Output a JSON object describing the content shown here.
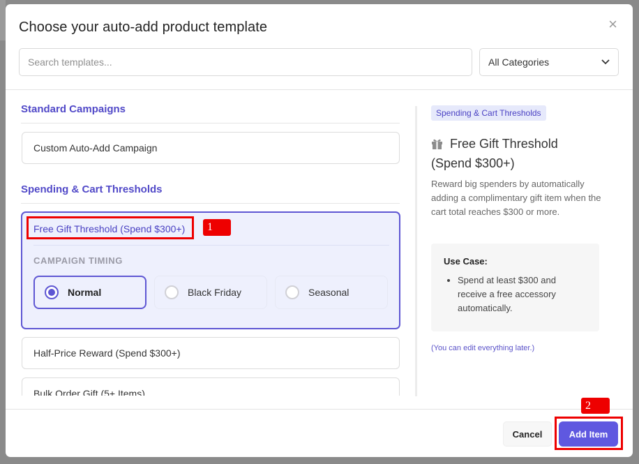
{
  "modal": {
    "title": "Choose your auto-add product template",
    "close_glyph": "×"
  },
  "search": {
    "placeholder": "Search templates..."
  },
  "category_select": {
    "value": "All Categories"
  },
  "sections": [
    {
      "title": "Standard Campaigns",
      "items": [
        "Custom Auto-Add Campaign"
      ]
    },
    {
      "title": "Spending & Cart Thresholds",
      "selected_item": {
        "label": "Free Gift Threshold (Spend $300+)",
        "timing_label": "CAMPAIGN TIMING",
        "options": [
          "Normal",
          "Black Friday",
          "Seasonal"
        ],
        "selected_option": "Normal"
      },
      "items": [
        "Half-Price Reward (Spend $300+)",
        "Bulk Order Gift (5+ Items)"
      ]
    }
  ],
  "details": {
    "tag": "Spending & Cart Thresholds",
    "icon": "gift-icon",
    "title": "Free Gift Threshold (Spend $300+)",
    "description": "Reward big spenders by automatically adding a complimentary gift item when the cart total reaches $300 or more.",
    "use_case_title": "Use Case:",
    "use_case_items": [
      "Spend at least $300 and receive a free accessory automatically."
    ],
    "note": "(You can edit everything later.)"
  },
  "footer": {
    "cancel_label": "Cancel",
    "add_label": "Add Item"
  },
  "annotations": [
    "1",
    "2"
  ],
  "colors": {
    "accent": "#5e56d3",
    "primary_button": "#5f58e0",
    "annotation": "#ee0000",
    "selected_bg": "#eef0fd"
  }
}
